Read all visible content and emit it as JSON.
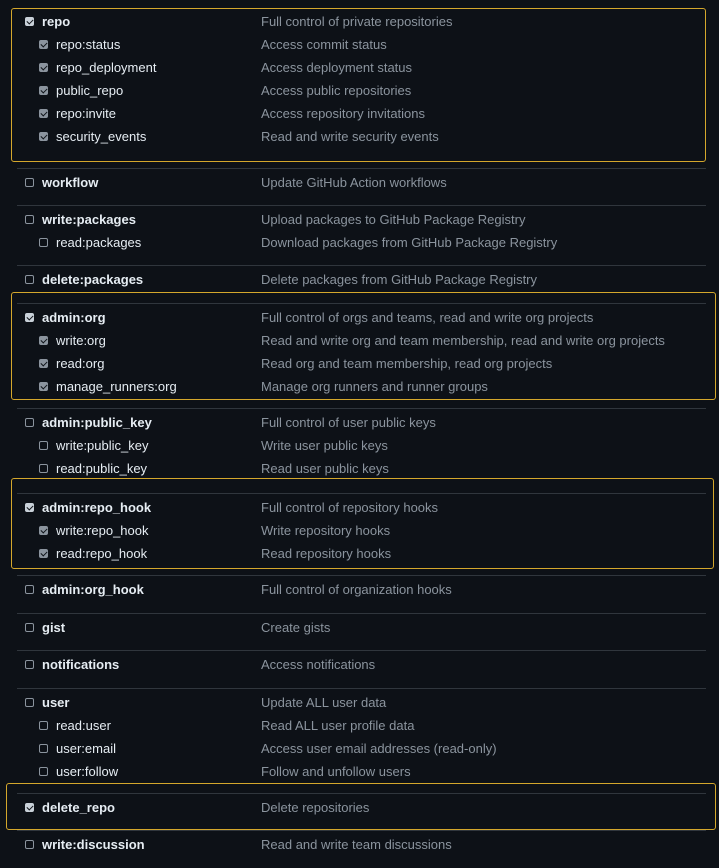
{
  "scope_groups": [
    {
      "name": "repo",
      "desc": "Full control of private repositories",
      "checked": true,
      "highlighted": true,
      "subs": [
        {
          "name": "repo:status",
          "desc": "Access commit status",
          "checked": true
        },
        {
          "name": "repo_deployment",
          "desc": "Access deployment status",
          "checked": true
        },
        {
          "name": "public_repo",
          "desc": "Access public repositories",
          "checked": true
        },
        {
          "name": "repo:invite",
          "desc": "Access repository invitations",
          "checked": true
        },
        {
          "name": "security_events",
          "desc": "Read and write security events",
          "checked": true
        }
      ]
    },
    {
      "name": "workflow",
      "desc": "Update GitHub Action workflows",
      "checked": false,
      "subs": []
    },
    {
      "name": "write:packages",
      "desc": "Upload packages to GitHub Package Registry",
      "checked": false,
      "subs": [
        {
          "name": "read:packages",
          "desc": "Download packages from GitHub Package Registry",
          "checked": false
        }
      ]
    },
    {
      "name": "delete:packages",
      "desc": "Delete packages from GitHub Package Registry",
      "checked": false,
      "subs": []
    },
    {
      "name": "admin:org",
      "desc": "Full control of orgs and teams, read and write org projects",
      "checked": true,
      "highlighted": true,
      "subs": [
        {
          "name": "write:org",
          "desc": "Read and write org and team membership, read and write org projects",
          "checked": true
        },
        {
          "name": "read:org",
          "desc": "Read org and team membership, read org projects",
          "checked": true
        },
        {
          "name": "manage_runners:org",
          "desc": "Manage org runners and runner groups",
          "checked": true
        }
      ]
    },
    {
      "name": "admin:public_key",
      "desc": "Full control of user public keys",
      "checked": false,
      "subs": [
        {
          "name": "write:public_key",
          "desc": "Write user public keys",
          "checked": false
        },
        {
          "name": "read:public_key",
          "desc": "Read user public keys",
          "checked": false
        }
      ]
    },
    {
      "name": "admin:repo_hook",
      "desc": "Full control of repository hooks",
      "checked": true,
      "highlighted": true,
      "subs": [
        {
          "name": "write:repo_hook",
          "desc": "Write repository hooks",
          "checked": true
        },
        {
          "name": "read:repo_hook",
          "desc": "Read repository hooks",
          "checked": true
        }
      ]
    },
    {
      "name": "admin:org_hook",
      "desc": "Full control of organization hooks",
      "checked": false,
      "subs": []
    },
    {
      "name": "gist",
      "desc": "Create gists",
      "checked": false,
      "subs": []
    },
    {
      "name": "notifications",
      "desc": "Access notifications",
      "checked": false,
      "subs": []
    },
    {
      "name": "user",
      "desc": "Update ALL user data",
      "checked": false,
      "subs": [
        {
          "name": "read:user",
          "desc": "Read ALL user profile data",
          "checked": false
        },
        {
          "name": "user:email",
          "desc": "Access user email addresses (read-only)",
          "checked": false
        },
        {
          "name": "user:follow",
          "desc": "Follow and unfollow users",
          "checked": false
        }
      ]
    },
    {
      "name": "delete_repo",
      "desc": "Delete repositories",
      "checked": true,
      "highlighted": true,
      "subs": []
    },
    {
      "name": "write:discussion",
      "desc": "Read and write team discussions",
      "checked": false,
      "subs": []
    }
  ],
  "colors": {
    "background": "#0d1117",
    "text": "#e6edf3",
    "muted": "#8b949e",
    "divider": "#30363d",
    "highlight": "#d4a72c"
  }
}
